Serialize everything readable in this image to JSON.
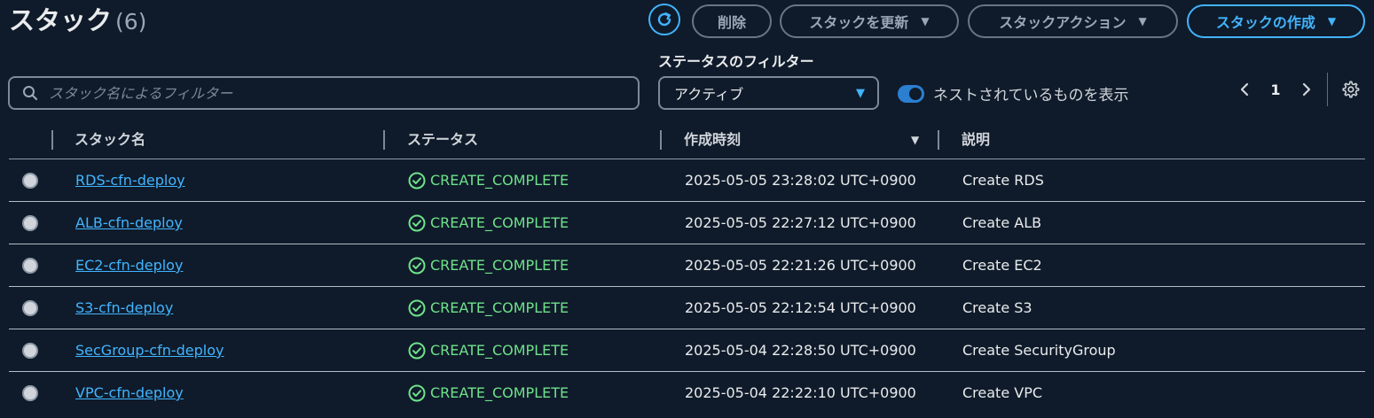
{
  "header": {
    "title": "スタック",
    "count": "(6)"
  },
  "toolbar": {
    "refresh_icon": "refresh-icon",
    "delete_label": "削除",
    "update_label": "スタックを更新",
    "actions_label": "スタックアクション",
    "create_label": "スタックの作成"
  },
  "filters": {
    "search_placeholder": "スタック名によるフィルター",
    "status_label": "ステータスのフィルター",
    "status_value": "アクティブ",
    "nested_label": "ネストされているものを表示",
    "nested_enabled": true
  },
  "pagination": {
    "current_page": "1"
  },
  "table": {
    "headers": {
      "name": "スタック名",
      "status": "ステータス",
      "created": "作成時刻",
      "description": "説明"
    },
    "rows": [
      {
        "name": "RDS-cfn-deploy",
        "status": "CREATE_COMPLETE",
        "created": "2025-05-05 23:28:02 UTC+0900",
        "description": "Create RDS"
      },
      {
        "name": "ALB-cfn-deploy",
        "status": "CREATE_COMPLETE",
        "created": "2025-05-05 22:27:12 UTC+0900",
        "description": "Create ALB"
      },
      {
        "name": "EC2-cfn-deploy",
        "status": "CREATE_COMPLETE",
        "created": "2025-05-05 22:21:26 UTC+0900",
        "description": "Create EC2"
      },
      {
        "name": "S3-cfn-deploy",
        "status": "CREATE_COMPLETE",
        "created": "2025-05-05 22:12:54 UTC+0900",
        "description": "Create S3"
      },
      {
        "name": "SecGroup-cfn-deploy",
        "status": "CREATE_COMPLETE",
        "created": "2025-05-04 22:28:50 UTC+0900",
        "description": "Create SecurityGroup"
      },
      {
        "name": "VPC-cfn-deploy",
        "status": "CREATE_COMPLETE",
        "created": "2025-05-04 22:22:10 UTC+0900",
        "description": "Create VPC"
      }
    ]
  },
  "colors": {
    "background": "#0f1b2a",
    "accent": "#42b4ff",
    "success": "#6fe28a"
  }
}
